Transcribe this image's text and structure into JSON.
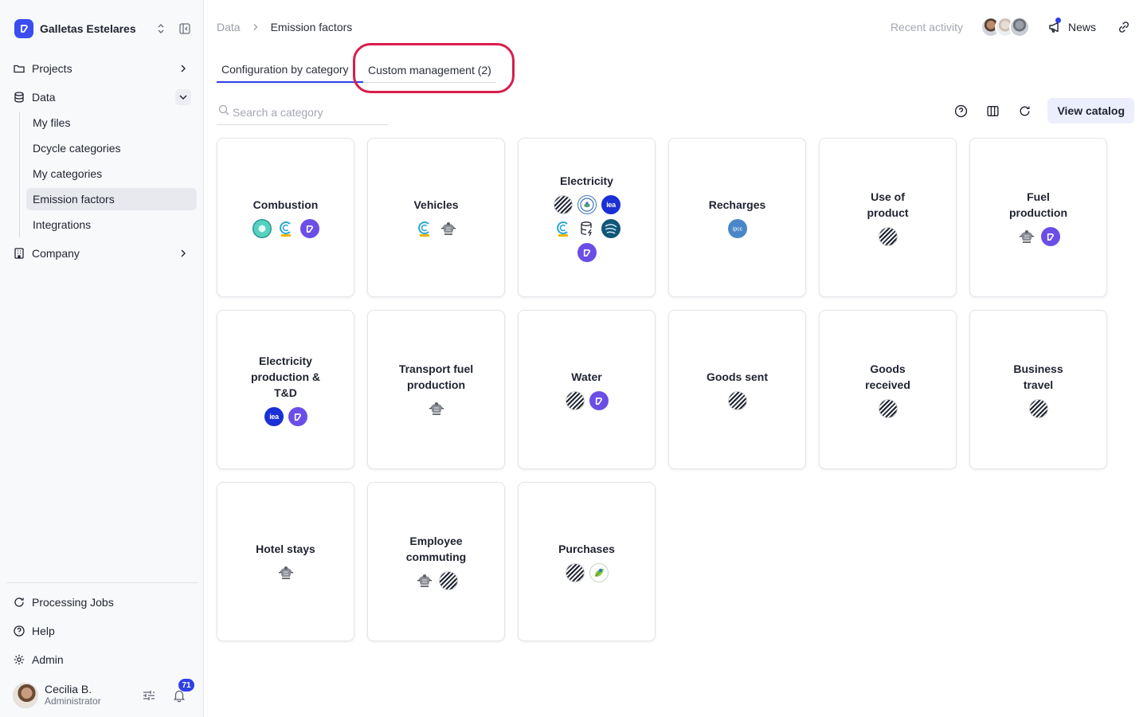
{
  "sidebar": {
    "org_name": "Galletas Estelares",
    "nav": [
      {
        "label": "Projects",
        "icon": "folder-icon"
      },
      {
        "label": "Data",
        "icon": "database-icon"
      },
      {
        "label": "Company",
        "icon": "building-icon"
      }
    ],
    "data_items": [
      "My files",
      "Dcycle categories",
      "My categories",
      "Emission factors",
      "Integrations"
    ],
    "active_item": "Emission factors",
    "bottom": [
      {
        "label": "Processing Jobs",
        "icon": "refresh-icon"
      },
      {
        "label": "Help",
        "icon": "help-circle-icon"
      },
      {
        "label": "Admin",
        "icon": "gear-icon"
      }
    ],
    "user": {
      "name": "Cecilia B.",
      "role": "Administrator",
      "notifications": "71"
    }
  },
  "header": {
    "breadcrumb": [
      "Data",
      "Emission factors"
    ],
    "recent_activity": "Recent activity",
    "news": "News"
  },
  "tabs": [
    {
      "label": "Configuration by category",
      "active": true
    },
    {
      "label": "Custom management (2)",
      "active": false
    }
  ],
  "search": {
    "placeholder": "Search a category"
  },
  "toolbar": {
    "catalog_button": "View catalog"
  },
  "categories": [
    {
      "title": "Combustion",
      "sources": [
        "teal",
        "cnmc",
        "dcycle"
      ]
    },
    {
      "title": "Vehicles",
      "sources": [
        "cnmc",
        "crest"
      ]
    },
    {
      "title": "Electricity",
      "sources": [
        "stripes",
        "epa",
        "iea",
        "cnmc",
        "db",
        "wave",
        "dcycle"
      ]
    },
    {
      "title": "Recharges",
      "sources": [
        "ipcc"
      ]
    },
    {
      "title": "Use of product",
      "sources": [
        "stripes"
      ]
    },
    {
      "title": "Fuel production",
      "sources": [
        "crest",
        "dcycle"
      ]
    },
    {
      "title": "Electricity production & T&D",
      "sources": [
        "iea",
        "dcycle"
      ]
    },
    {
      "title": "Transport fuel production",
      "sources": [
        "crest"
      ]
    },
    {
      "title": "Water",
      "sources": [
        "stripes",
        "dcycle"
      ]
    },
    {
      "title": "Goods sent",
      "sources": [
        "stripes"
      ]
    },
    {
      "title": "Goods received",
      "sources": [
        "stripes"
      ]
    },
    {
      "title": "Business travel",
      "sources": [
        "stripes"
      ]
    },
    {
      "title": "Hotel stays",
      "sources": [
        "crest"
      ]
    },
    {
      "title": "Employee commuting",
      "sources": [
        "crest",
        "stripes"
      ]
    },
    {
      "title": "Purchases",
      "sources": [
        "stripes",
        "leaf"
      ]
    }
  ],
  "colors": {
    "accent": "#3040e8",
    "highlight": "#d81e4c",
    "dcycle": "#6b4ee6",
    "iea": "#1a2fd6"
  }
}
